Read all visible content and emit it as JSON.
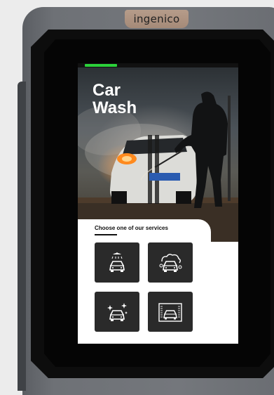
{
  "device": {
    "brand": "ingenico"
  },
  "screen": {
    "progress": 0.2,
    "hero": {
      "title_line1": "Car",
      "title_line2": "Wash",
      "image": "car-wash-photo"
    },
    "services": {
      "heading": "Choose one of our services",
      "items": [
        {
          "icon": "car-shower-wash-icon"
        },
        {
          "icon": "car-foam-wash-icon"
        },
        {
          "icon": "car-shine-icon"
        },
        {
          "icon": "car-brush-tunnel-icon"
        }
      ]
    }
  },
  "colors": {
    "accent_green": "#2bd13a",
    "button_bg": "#2a2a2a",
    "bezel": "#0d0d0d",
    "housing": "#6e7176"
  }
}
